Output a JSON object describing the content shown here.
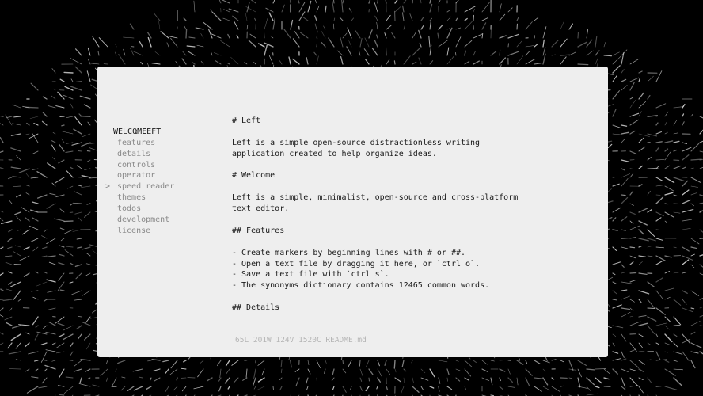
{
  "navigation": {
    "prefix": ":",
    "title": "LEFT",
    "section": "WELCOME",
    "items": [
      {
        "label": "features"
      },
      {
        "label": "details"
      },
      {
        "label": "controls"
      },
      {
        "label": "operator"
      },
      {
        "label": "speed reader",
        "marker": ">"
      },
      {
        "label": "themes"
      },
      {
        "label": "todos"
      },
      {
        "label": "development"
      },
      {
        "label": "license"
      }
    ]
  },
  "editor": {
    "lines": [
      "# Left",
      "",
      "Left is a simple open-source distractionless writing",
      "application created to help organize ideas.",
      "",
      "# Welcome",
      "",
      "Left is a simple, minimalist, open-source and cross-platform",
      "text editor.",
      "",
      "## Features",
      "",
      "- Create markers by beginning lines with # or ##.",
      "- Open a text file by dragging it here, or `ctrl o`.",
      "- Save a text file with `ctrl s`.",
      "- The synonyms dictionary contains 12465 common words.",
      "",
      "## Details"
    ]
  },
  "status": {
    "text": "65L 201W 124V 1520C README.md"
  },
  "colors": {
    "background": "#000000",
    "window": "#eeeeee",
    "text": "#1a1a1a",
    "muted": "#8a8a8a",
    "stats": "#b5b5b5"
  }
}
